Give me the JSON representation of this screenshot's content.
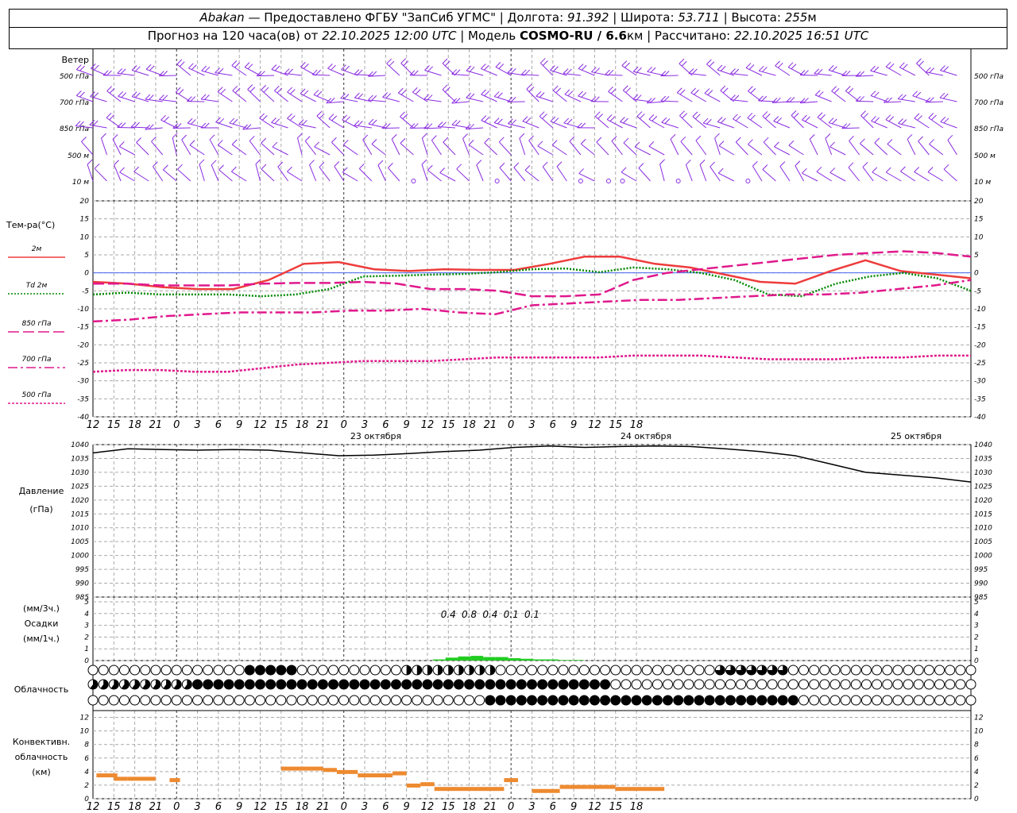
{
  "header": {
    "station": "Abakan",
    "provider": "— Предоставлено ФГБУ \"ЗапСиб УГМС\"",
    "lon_label": "Долгота:",
    "lon": "91.392",
    "lat_label": "Широта:",
    "lat": "53.711",
    "alt_label": "Высота:",
    "alt": "255",
    "alt_unit": "м",
    "forecast_label": "Прогноз на 120 часа(ов) от",
    "forecast_start": "22.10.2025 12:00 UTC",
    "model_label": "Модель",
    "model": "COSMO-RU / 6.6",
    "model_unit": "км",
    "computed_label": "Рассчитано:",
    "computed": "22.10.2025 16:51 UTC"
  },
  "chart_data": [
    {
      "type": "wind-barbs",
      "title": "Ветер",
      "levels": [
        "500 гПа",
        "700 гПа",
        "850 гПа",
        "500 м",
        "10  м"
      ]
    },
    {
      "type": "line",
      "ylabel": "Тем-ра(°C)",
      "ylim": [
        -40,
        20
      ],
      "yticks": [
        20,
        15,
        10,
        5,
        0,
        -5,
        -10,
        -15,
        -20,
        -25,
        -30,
        -35,
        -40
      ],
      "x_hours": [
        0,
        6,
        12,
        18,
        24,
        30,
        36,
        42,
        48,
        54,
        60,
        66,
        72,
        78,
        84,
        90,
        96,
        102,
        108,
        114,
        120,
        126
      ],
      "series": [
        {
          "name": "2м",
          "color": "#ee3c3c",
          "style": "solid",
          "values": [
            -2.5,
            -3,
            -4,
            -4.5,
            -4.5,
            -2,
            2.5,
            3,
            1,
            0.5,
            1,
            0.8,
            0.8,
            2.5,
            4.5,
            4.5,
            2.5,
            1.5,
            -0.5,
            -2.5,
            -3,
            0.5,
            3.5,
            0.5,
            -0.5,
            -1.5
          ]
        },
        {
          "name": "Td  2м",
          "color": "#008800",
          "style": "dotted",
          "values": [
            -6,
            -5.5,
            -6,
            -6,
            -6,
            -6.5,
            -6,
            -4.5,
            -1,
            -0.8,
            -0.5,
            -0.3,
            0.2,
            1,
            1.2,
            0.2,
            1.5,
            1,
            0,
            -2,
            -6,
            -6.5,
            -3,
            -1,
            0,
            -1.5,
            -5
          ]
        },
        {
          "name": "850 гПа",
          "color": "#e0188c",
          "style": "longdash",
          "values": [
            -3,
            -3,
            -3.5,
            -3.5,
            -3.5,
            -3,
            -2.8,
            -2.8,
            -2.5,
            -3,
            -4.5,
            -4.5,
            -5,
            -6.5,
            -6.5,
            -6,
            -2,
            0,
            1,
            2,
            3,
            4,
            5,
            5.5,
            6,
            5.5,
            4.5
          ]
        },
        {
          "name": "700 гПа",
          "color": "#e0188c",
          "style": "dashdot",
          "values": [
            -13.5,
            -13,
            -12,
            -11.5,
            -11,
            -11,
            -11,
            -10.5,
            -10.5,
            -10,
            -11,
            -11.5,
            -9,
            -8.5,
            -8,
            -7.5,
            -7.5,
            -7,
            -6.5,
            -6,
            -6,
            -5.5,
            -4.5,
            -3.5,
            -2
          ]
        },
        {
          "name": "500 гПа",
          "color": "#e0188c",
          "style": "dense-dotted",
          "values": [
            -27.5,
            -27,
            -27,
            -27.5,
            -27.5,
            -26.5,
            -25.5,
            -25,
            -24.5,
            -24.5,
            -24.5,
            -24,
            -23.5,
            -23.5,
            -23.5,
            -23.5,
            -23,
            -23,
            -23,
            -23.5,
            -24,
            -24,
            -24,
            -23.5,
            -23.5,
            -23,
            -23
          ]
        }
      ]
    },
    {
      "type": "line",
      "ylabel_1": "Давление",
      "ylabel_2": "(гПа)",
      "ylim": [
        985,
        1040
      ],
      "yticks": [
        1040,
        1035,
        1030,
        1025,
        1020,
        1015,
        1010,
        1005,
        1000,
        995,
        990,
        985
      ],
      "series": [
        {
          "name": "Давление",
          "color": "#000000",
          "values": [
            1037,
            1038.5,
            1038.2,
            1038,
            1038.2,
            1038,
            1037,
            1036,
            1036.2,
            1036.8,
            1037.5,
            1038,
            1039,
            1039.5,
            1039,
            1039.3,
            1039.5,
            1039.3,
            1038.5,
            1037.5,
            1036,
            1033,
            1030,
            1029,
            1028,
            1026.5
          ]
        }
      ]
    },
    {
      "type": "bar",
      "ylabel_1": "(мм/3ч.)",
      "ylabel_2": "Осадки",
      "ylabel_3": "(мм/1ч.)",
      "ylim": [
        0,
        5
      ],
      "yticks": [
        5,
        4,
        3,
        2,
        1,
        0
      ],
      "totals_3h": [
        "0.4",
        "0.8",
        "0.4",
        "0.1",
        "0.1"
      ],
      "hourly": [
        0,
        0.1,
        0.25,
        0.35,
        0.4,
        0.3,
        0.3,
        0.2,
        0.15,
        0.1,
        0.1,
        0.05,
        0.05
      ]
    },
    {
      "type": "table",
      "ylabel": "Облачность",
      "rows": [
        "high",
        "middle",
        "low"
      ]
    },
    {
      "type": "bar",
      "ylabel_1": "Конвективн.",
      "ylabel_2": "облачность",
      "ylabel_3": "(км)",
      "ylim": [
        0,
        13
      ],
      "yticks": [
        12,
        10,
        8,
        6,
        4,
        2,
        0
      ],
      "segments_km": [
        3.5,
        3,
        3,
        2.8,
        4.5,
        4.3,
        4,
        3.5,
        3.8,
        2,
        2.2,
        1.5,
        1.5,
        2.8,
        1.2,
        1.8,
        1.8,
        1.5
      ]
    }
  ],
  "x_axis": {
    "tick_labels": [
      "12",
      "15",
      "18",
      "21",
      "0",
      "3",
      "6",
      "9",
      "12",
      "15",
      "18",
      "21",
      "0",
      "3",
      "6",
      "9",
      "12",
      "15",
      "18",
      "21",
      "0",
      "3",
      "6",
      "9",
      "12",
      "15",
      "18"
    ],
    "dates": [
      "23 октября",
      "24 октября",
      "25 октября"
    ]
  },
  "colors": {
    "wind": "#8a2be2",
    "precip": "#22cc22",
    "convective": "#ee8a30",
    "grid": "#aaaaaa"
  }
}
